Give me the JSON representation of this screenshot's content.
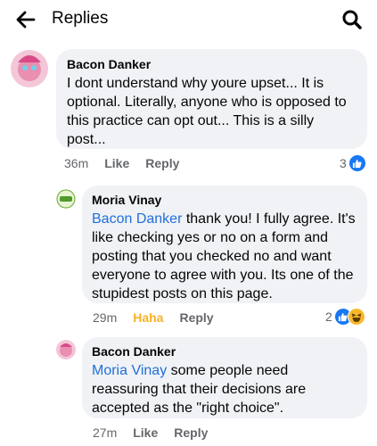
{
  "header": {
    "title": "Replies"
  },
  "comments": [
    {
      "author": "Bacon Danker",
      "mention": "",
      "text": "I dont understand why youre upset... It is optional. Literally, anyone who is opposed to this practice can opt out... This is a silly post...",
      "time": "36m",
      "like_label": "Like",
      "reply_label": "Reply",
      "reaction_count": "3"
    },
    {
      "author": "Moria Vinay",
      "mention": "Bacon Danker",
      "text": " thank you! I fully agree. It's like checking yes or no on a form and posting that you checked no and want everyone to agree with you. Its one of the stupidest posts on this page.",
      "time": "29m",
      "like_label": "Haha",
      "reply_label": "Reply",
      "reaction_count": "2"
    },
    {
      "author": "Bacon Danker",
      "mention": "Moria Vinay",
      "text": " some people need reassuring that their decisions are accepted as the \"right choice\".",
      "time": "27m",
      "like_label": "Like",
      "reply_label": "Reply",
      "reaction_count": ""
    }
  ],
  "colors": {
    "mention": "#216fdb",
    "bubble": "#f0f2f5",
    "haha": "#f7b125",
    "like_reaction": "#1877f2"
  },
  "icons": {
    "back": "arrow-left-icon",
    "search": "search-icon",
    "like_reaction": "thumbs-up-icon",
    "haha_reaction": "laughing-face-icon"
  }
}
